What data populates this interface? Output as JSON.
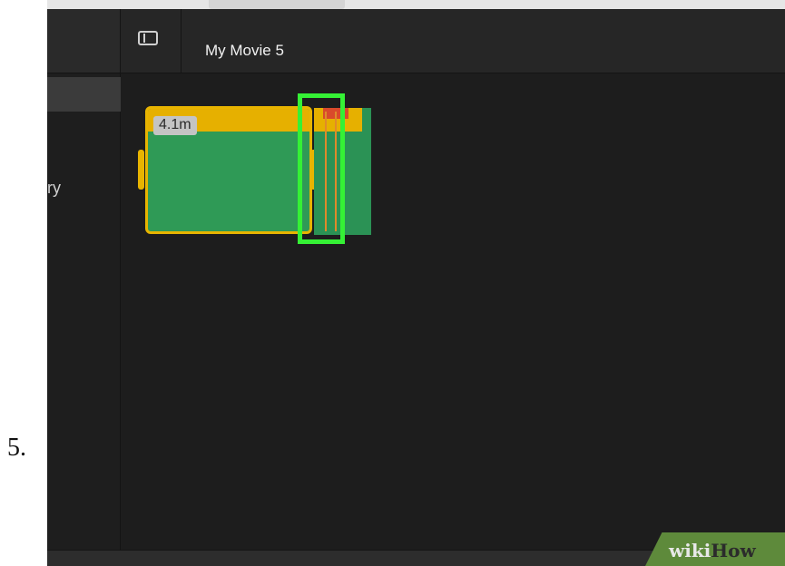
{
  "step_number": "5.",
  "titlebar": {
    "movie_title": "My Movie 5",
    "sidebar_toggle_icon": "sidebar-toggle-icon"
  },
  "sidebar": {
    "item_label_partial": "ry"
  },
  "timeline": {
    "clip": {
      "duration_badge": "4.1m",
      "add_label": "+"
    }
  },
  "watermark": {
    "wiki": "wiki",
    "how": "How"
  },
  "colors": {
    "clip_green": "#2f9a56",
    "clip_border": "#e8b400",
    "highlight": "#35f135",
    "transition_line": "#e08a2a"
  }
}
